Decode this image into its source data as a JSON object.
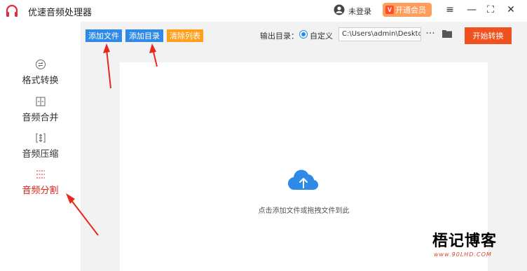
{
  "app": {
    "title": "优速音频处理器",
    "login_text": "未登录",
    "vip_label": "开通会员",
    "vip_badge": "V"
  },
  "window_controls": {
    "menu": "≡",
    "minimize": "—",
    "maximize": "⛶",
    "close": "✕"
  },
  "sidebar": {
    "items": [
      {
        "label": "格式转换",
        "icon": "format-convert-icon",
        "active": false
      },
      {
        "label": "音频合并",
        "icon": "audio-merge-icon",
        "active": false
      },
      {
        "label": "音频压缩",
        "icon": "audio-compress-icon",
        "active": false
      },
      {
        "label": "音频分割",
        "icon": "audio-split-icon",
        "active": true
      }
    ]
  },
  "toolbar": {
    "add_file": "添加文件",
    "add_dir": "添加目录",
    "clear_list": "清除列表",
    "output_label": "输出目录：",
    "custom_label": "自定义",
    "path_value": "C:\\Users\\admin\\Deskto",
    "more": "···",
    "start": "开始转换"
  },
  "dropzone": {
    "text": "点击添加文件或拖拽文件到此"
  },
  "watermark": {
    "main": "梧记博客",
    "sub": "www.90LHD.COM"
  },
  "colors": {
    "blue": "#2e8ae6",
    "orange": "#ff9f1c",
    "red": "#f0521f",
    "active_red": "#e02020",
    "annotation_red": "#e8281e"
  }
}
